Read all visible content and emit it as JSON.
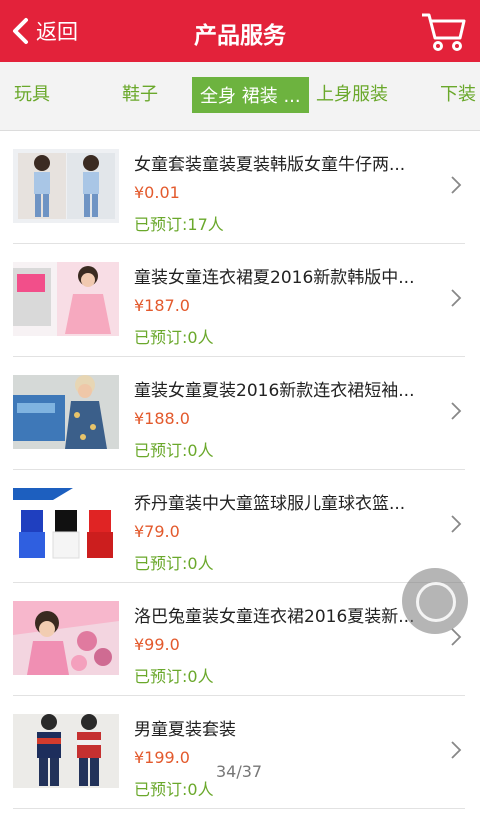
{
  "header": {
    "back_label": "返回",
    "title": "产品服务",
    "accent_color": "#e3223a"
  },
  "tabs": [
    "玩具",
    "鞋子",
    "全身 裙装 ...",
    "上身服装",
    "下装"
  ],
  "active_tab_index": 2,
  "items": [
    {
      "name": "女童套装童装夏装韩版女童牛仔两...",
      "price": "¥0.01",
      "booked": "已预订:17人"
    },
    {
      "name": "童装女童连衣裙夏2016新款韩版中...",
      "price": "¥187.0",
      "booked": "已预订:0人"
    },
    {
      "name": "童装女童夏装2016新款连衣裙短袖...",
      "price": "¥188.0",
      "booked": "已预订:0人"
    },
    {
      "name": "乔丹童装中大童篮球服儿童球衣篮...",
      "price": "¥79.0",
      "booked": "已预订:0人"
    },
    {
      "name": "洛巴兔童装女童连衣裙2016夏装新...",
      "price": "¥99.0",
      "booked": "已预订:0人"
    },
    {
      "name": "男童夏装套装",
      "price": "¥199.0",
      "booked": "已预订:0人"
    }
  ],
  "pager": "34/37"
}
